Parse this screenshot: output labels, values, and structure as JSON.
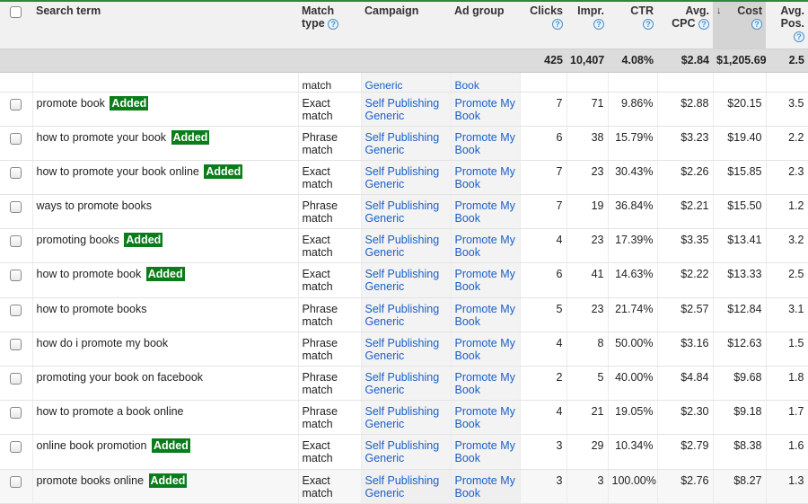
{
  "table": {
    "columns": [
      {
        "key": "search_term",
        "label": "Search term",
        "help": false
      },
      {
        "key": "match_type",
        "label": "Match type",
        "help": true
      },
      {
        "key": "campaign",
        "label": "Campaign",
        "help": false
      },
      {
        "key": "ad_group",
        "label": "Ad group",
        "help": false
      },
      {
        "key": "clicks",
        "label": "Clicks",
        "help": true
      },
      {
        "key": "impr",
        "label": "Impr.",
        "help": true
      },
      {
        "key": "ctr",
        "label": "CTR",
        "help": true
      },
      {
        "key": "avg_cpc",
        "label": "Avg. CPC",
        "help": true
      },
      {
        "key": "cost",
        "label": "Cost",
        "help": true,
        "sorted": "descending"
      },
      {
        "key": "avg_pos",
        "label": "Avg. Pos.",
        "help": true
      }
    ],
    "help_glyph": "?",
    "sort_glyph": "↓",
    "totals": {
      "clicks": "425",
      "impr": "10,407",
      "ctr": "4.08%",
      "avg_cpc": "$2.84",
      "cost": "$1,205.69",
      "avg_pos": "2.5"
    },
    "partial_row": {
      "match_type": "match",
      "campaign": "Generic",
      "ad_group": "Book"
    },
    "added_label": "Added",
    "rows": [
      {
        "term": "promote book",
        "added": true,
        "match": "Exact match",
        "campaign": "Self Publishing Generic",
        "ad_group": "Promote My Book",
        "clicks": "7",
        "impr": "71",
        "ctr": "9.86%",
        "cpc": "$2.88",
        "cost": "$20.15",
        "pos": "3.5"
      },
      {
        "term": "how to promote your book",
        "added": true,
        "match": "Phrase match",
        "campaign": "Self Publishing Generic",
        "ad_group": "Promote My Book",
        "clicks": "6",
        "impr": "38",
        "ctr": "15.79%",
        "cpc": "$3.23",
        "cost": "$19.40",
        "pos": "2.2"
      },
      {
        "term": "how to promote your book online",
        "added": true,
        "match": "Exact match",
        "campaign": "Self Publishing Generic",
        "ad_group": "Promote My Book",
        "clicks": "7",
        "impr": "23",
        "ctr": "30.43%",
        "cpc": "$2.26",
        "cost": "$15.85",
        "pos": "2.3"
      },
      {
        "term": "ways to promote books",
        "added": false,
        "match": "Phrase match",
        "campaign": "Self Publishing Generic",
        "ad_group": "Promote My Book",
        "clicks": "7",
        "impr": "19",
        "ctr": "36.84%",
        "cpc": "$2.21",
        "cost": "$15.50",
        "pos": "1.2"
      },
      {
        "term": "promoting books",
        "added": true,
        "match": "Exact match",
        "campaign": "Self Publishing Generic",
        "ad_group": "Promote My Book",
        "clicks": "4",
        "impr": "23",
        "ctr": "17.39%",
        "cpc": "$3.35",
        "cost": "$13.41",
        "pos": "3.2"
      },
      {
        "term": "how to promote book",
        "added": true,
        "match": "Exact match",
        "campaign": "Self Publishing Generic",
        "ad_group": "Promote My Book",
        "clicks": "6",
        "impr": "41",
        "ctr": "14.63%",
        "cpc": "$2.22",
        "cost": "$13.33",
        "pos": "2.5"
      },
      {
        "term": "how to promote books",
        "added": false,
        "match": "Phrase match",
        "campaign": "Self Publishing Generic",
        "ad_group": "Promote My Book",
        "clicks": "5",
        "impr": "23",
        "ctr": "21.74%",
        "cpc": "$2.57",
        "cost": "$12.84",
        "pos": "3.1"
      },
      {
        "term": "how do i promote my book",
        "added": false,
        "match": "Phrase match",
        "campaign": "Self Publishing Generic",
        "ad_group": "Promote My Book",
        "clicks": "4",
        "impr": "8",
        "ctr": "50.00%",
        "cpc": "$3.16",
        "cost": "$12.63",
        "pos": "1.5"
      },
      {
        "term": "promoting your book on facebook",
        "added": false,
        "match": "Phrase match",
        "campaign": "Self Publishing Generic",
        "ad_group": "Promote My Book",
        "clicks": "2",
        "impr": "5",
        "ctr": "40.00%",
        "cpc": "$4.84",
        "cost": "$9.68",
        "pos": "1.8"
      },
      {
        "term": "how to promote a book online",
        "added": false,
        "match": "Phrase match",
        "campaign": "Self Publishing Generic",
        "ad_group": "Promote My Book",
        "clicks": "4",
        "impr": "21",
        "ctr": "19.05%",
        "cpc": "$2.30",
        "cost": "$9.18",
        "pos": "1.7"
      },
      {
        "term": "online book promotion",
        "added": true,
        "match": "Exact match",
        "campaign": "Self Publishing Generic",
        "ad_group": "Promote My Book",
        "clicks": "3",
        "impr": "29",
        "ctr": "10.34%",
        "cpc": "$2.79",
        "cost": "$8.38",
        "pos": "1.6"
      },
      {
        "term": "promote books online",
        "added": true,
        "match": "Exact match",
        "campaign": "Self Publishing Generic",
        "ad_group": "Promote My Book",
        "clicks": "3",
        "impr": "3",
        "ctr": "100.00%",
        "cpc": "$2.76",
        "cost": "$8.27",
        "pos": "1.3"
      }
    ]
  }
}
